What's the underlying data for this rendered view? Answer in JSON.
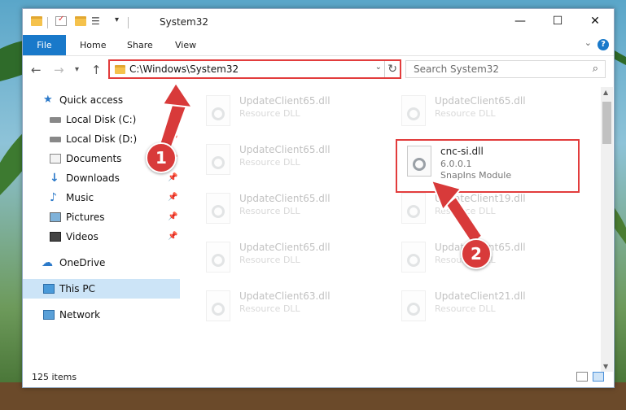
{
  "window": {
    "title": "System32",
    "controls": {
      "minimize": "—",
      "maximize": "☐",
      "close": "✕"
    }
  },
  "ribbon": {
    "file_label": "File",
    "tabs": [
      "Home",
      "Share",
      "View"
    ],
    "help": "?"
  },
  "navigation": {
    "address": "C:\\Windows\\System32",
    "search_placeholder": "Search System32"
  },
  "sidebar": {
    "items": [
      {
        "label": "Quick access",
        "icon": "star-icon"
      },
      {
        "label": "Local Disk (C:)",
        "icon": "drive-icon"
      },
      {
        "label": "Local Disk (D:)",
        "icon": "drive-icon"
      },
      {
        "label": "Documents",
        "icon": "documents-icon"
      },
      {
        "label": "Downloads",
        "icon": "download-icon"
      },
      {
        "label": "Music",
        "icon": "music-icon"
      },
      {
        "label": "Pictures",
        "icon": "pictures-icon"
      },
      {
        "label": "Videos",
        "icon": "videos-icon"
      },
      {
        "label": "OneDrive",
        "icon": "cloud-icon"
      },
      {
        "label": "This PC",
        "icon": "computer-icon"
      },
      {
        "label": "Network",
        "icon": "network-icon"
      }
    ]
  },
  "files": [
    {
      "name": "UpdateClient65.dll",
      "type": "Resource DLL"
    },
    {
      "name": "UpdateClient65.dll",
      "type": "Resource DLL"
    },
    {
      "name": "UpdateClient65.dll",
      "type": "Resource DLL"
    },
    {
      "name": "cnc-si.dll",
      "version": "6.0.0.1",
      "type": "SnapIns Module"
    },
    {
      "name": "UpdateClient65.dll",
      "type": "Resource DLL"
    },
    {
      "name": "UpdateClient19.dll",
      "type": "Resource DLL"
    },
    {
      "name": "UpdateClient65.dll",
      "type": "Resource DLL"
    },
    {
      "name": "UpdateClient65.dll",
      "type": "Resource DLL"
    },
    {
      "name": "UpdateClient63.dll",
      "type": "Resource DLL"
    },
    {
      "name": "UpdateClient21.dll",
      "type": "Resource DLL"
    }
  ],
  "status": {
    "items": "125 items"
  },
  "annotations": {
    "step1": "1",
    "step2": "2",
    "accent": "#d83a3a"
  }
}
